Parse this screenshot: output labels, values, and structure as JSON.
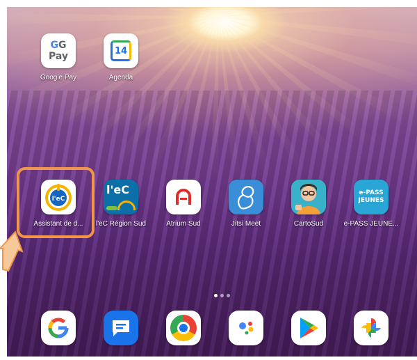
{
  "home_screen": {
    "top_row": [
      {
        "label": "Google Pay",
        "icon": "google-pay-icon",
        "icon_text": "G Pay"
      },
      {
        "label": "Agenda",
        "icon": "calendar-icon",
        "icon_text": "14"
      }
    ],
    "main_row": [
      {
        "label": "Assistant de d...",
        "icon": "assistant-ent-icon",
        "icon_text": "l'eC"
      },
      {
        "label": "l'eC Région Sud",
        "icon": "lec-region-sud-icon",
        "icon_text": "l'eC"
      },
      {
        "label": "Atrium Sud",
        "icon": "atrium-sud-icon",
        "icon_text": "A"
      },
      {
        "label": "Jitsi Meet",
        "icon": "jitsi-meet-icon"
      },
      {
        "label": "CartoSud",
        "icon": "cartosud-icon"
      },
      {
        "label": "e-PASS JEUNE...",
        "icon": "epass-jeunes-icon",
        "icon_text": "e-PASS JEUNES"
      }
    ],
    "page_indicator": {
      "pages": 3,
      "current": 1
    },
    "highlight_color": "#f0954a"
  },
  "dock": [
    {
      "name": "Google",
      "icon": "google-search-icon"
    },
    {
      "name": "Messages",
      "icon": "messages-icon"
    },
    {
      "name": "Chrome",
      "icon": "chrome-icon"
    },
    {
      "name": "Assistant",
      "icon": "google-assistant-icon"
    },
    {
      "name": "Play Store",
      "icon": "play-store-icon"
    },
    {
      "name": "Photos",
      "icon": "google-photos-icon"
    }
  ]
}
